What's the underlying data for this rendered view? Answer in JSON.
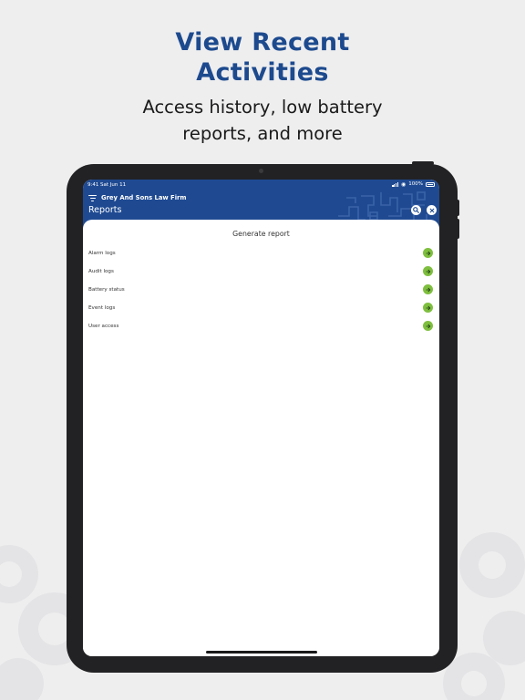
{
  "promo": {
    "headline_line1": "View Recent",
    "headline_line2": "Activities",
    "subline_line1": "Access history, low battery",
    "subline_line2": "reports, and more"
  },
  "status_bar": {
    "time": "9:41",
    "date": "Sat Jun 11",
    "battery_percent": "100%"
  },
  "header": {
    "org_name": "Grey And Sons Law Firm",
    "title": "Reports",
    "icons": [
      "menu-filter-icon",
      "search-icon",
      "close-icon"
    ]
  },
  "sheet": {
    "title": "Generate report",
    "items": [
      {
        "label": "Alarm logs"
      },
      {
        "label": "Audit logs"
      },
      {
        "label": "Battery status"
      },
      {
        "label": "Event logs"
      },
      {
        "label": "User access"
      }
    ]
  },
  "colors": {
    "brand_blue": "#1f4a92",
    "headline_blue": "#1d4a8e",
    "arrow_green": "#7fbf3f",
    "background": "#eeeeef"
  }
}
